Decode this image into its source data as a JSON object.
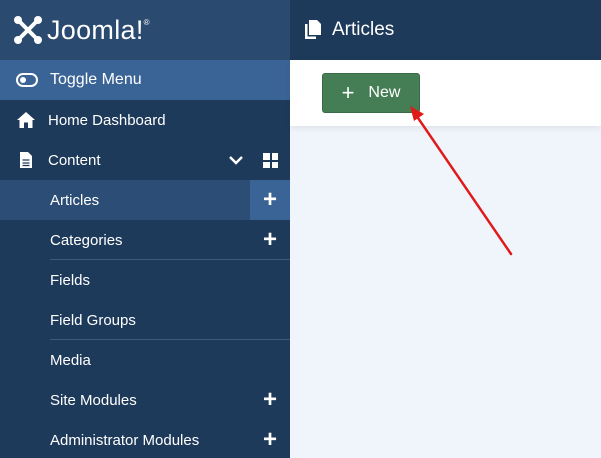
{
  "brand": {
    "name": "Joomla!",
    "trademark": "®"
  },
  "header": {
    "title": "Articles",
    "icon": "copy-icon"
  },
  "sidebar": {
    "toggle_label": "Toggle Menu",
    "home_label": "Home Dashboard",
    "content_label": "Content",
    "items": [
      {
        "label": "Articles",
        "has_add": true,
        "active": true
      },
      {
        "label": "Categories",
        "has_add": true
      },
      {
        "label": "Fields",
        "has_add": false
      },
      {
        "label": "Field Groups",
        "has_add": false
      },
      {
        "label": "Media",
        "has_add": false
      },
      {
        "label": "Site Modules",
        "has_add": true
      },
      {
        "label": "Administrator Modules",
        "has_add": true
      }
    ],
    "add_symbol": "+"
  },
  "toolbar": {
    "new_label": "New",
    "new_symbol": "+"
  },
  "colors": {
    "sidebar_bg": "#1e3a5a",
    "active_bg": "#3a6495",
    "new_button": "#457d54",
    "annotation_arrow": "#e01a1a"
  }
}
